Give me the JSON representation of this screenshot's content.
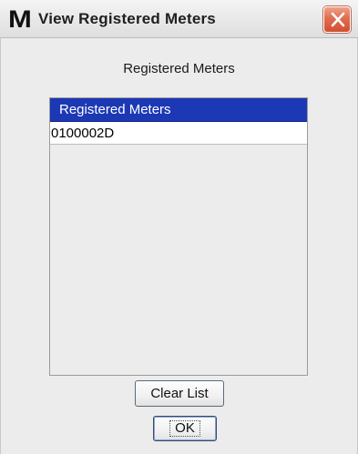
{
  "window": {
    "app_icon": "M",
    "title": "View Registered Meters",
    "close_icon": "close-icon"
  },
  "heading": "Registered Meters",
  "list": {
    "header": "Registered Meters",
    "items": [
      "0100002D"
    ]
  },
  "buttons": {
    "clear_label": "Clear List",
    "ok_label": "OK"
  },
  "colors": {
    "list_header_bg": "#1c38b5",
    "close_button_bg": "#e06c4f"
  }
}
